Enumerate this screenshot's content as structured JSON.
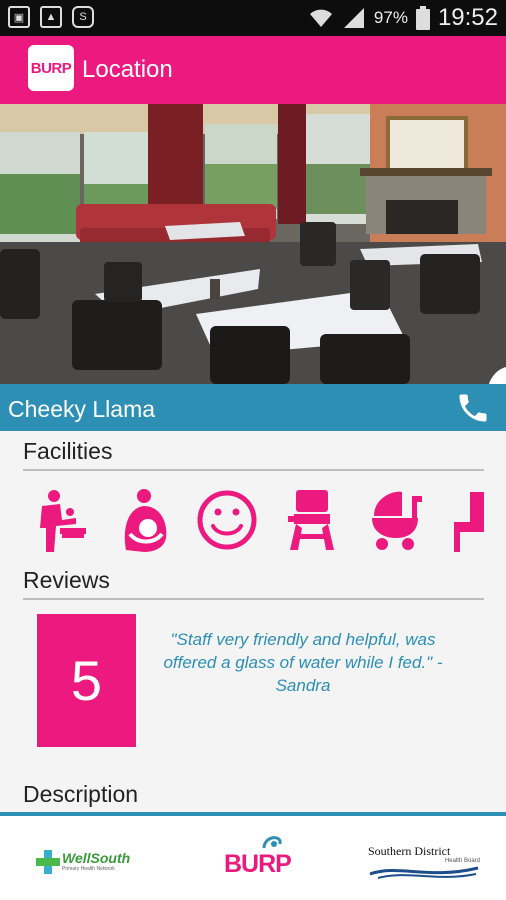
{
  "status_bar": {
    "battery_percent": "97%",
    "time": "19:52",
    "icons": [
      "sim-card-icon",
      "image-icon",
      "app-notification-icon",
      "wifi-icon",
      "signal-icon",
      "battery-icon"
    ]
  },
  "app_bar": {
    "logo_text": "BURP",
    "title": "Location",
    "color": "#ec1a7f"
  },
  "venue": {
    "name": "Cheeky Llama",
    "phone_icon": "phone-icon"
  },
  "facilities": {
    "title": "Facilities",
    "icons": [
      "baby-change-icon",
      "breastfeeding-icon",
      "smiley-icon",
      "high-chair-icon",
      "pram-icon",
      "seating-icon"
    ]
  },
  "reviews": {
    "title": "Reviews",
    "rating": "5",
    "text": "\"Staff very friendly and helpful, was offered a glass of water while I fed.\" - Sandra"
  },
  "description": {
    "title": "Description"
  },
  "footer": {
    "wellsouth_name": "WellSouth",
    "wellsouth_tagline": "Primary Health Network",
    "burp_text": "BURP",
    "sdhb_name": "Southern District",
    "sdhb_sub": "Health Board"
  },
  "colors": {
    "accent": "#ec1a7f",
    "secondary": "#2d8fb4"
  }
}
